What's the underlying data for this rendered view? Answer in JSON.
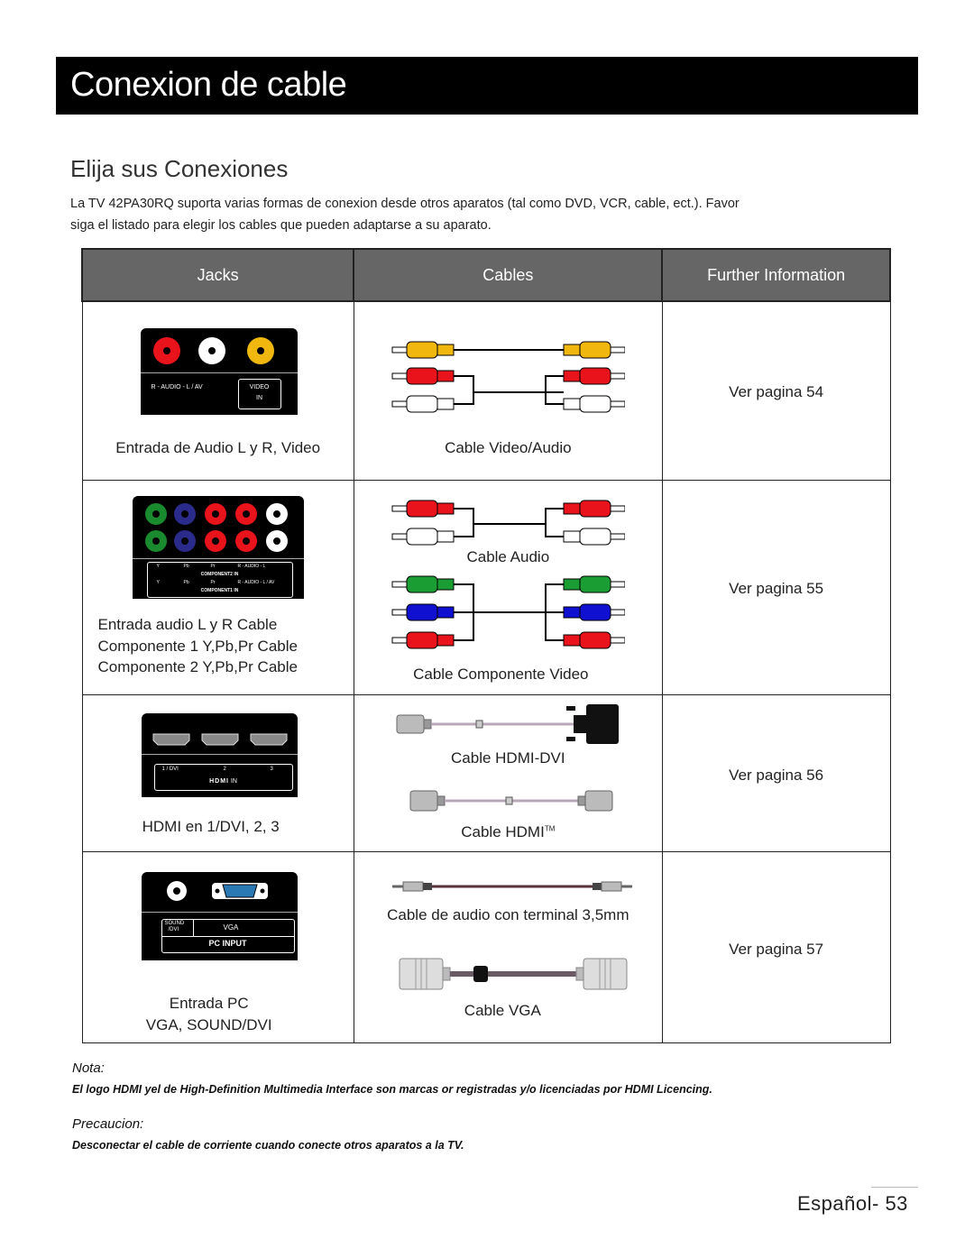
{
  "header": {
    "title": "Conexion de cable"
  },
  "section": {
    "subtitle": "Elija sus Conexiones",
    "intro_line1": "La TV  42PA30RQ suporta varias formas de conexion desde otros aparatos (tal como DVD, VCR, cable, ect.). Favor",
    "intro_line2": "siga el listado para elegir los cables que pueden adaptarse a su aparato."
  },
  "table": {
    "headers": [
      "Jacks",
      "Cables",
      "Further Information"
    ],
    "rows": [
      {
        "jack_panel": {
          "label_left": "R - AUDIO - L  / AV",
          "label_box_1": "VIDEO",
          "label_box_2": "IN",
          "jack_colors": [
            "#e8131b",
            "#ffffff",
            "#f0b80f"
          ]
        },
        "jack_caption": "Entrada de Audio L y R, Video",
        "cables": [
          {
            "label": "Cable Video/Audio"
          }
        ],
        "info": "Ver pagina 54"
      },
      {
        "jack_panel": {
          "row_colors": [
            "#1a8a2e",
            "#2b2b8c",
            "#e8131b",
            "#e8131b",
            "#ffffff"
          ],
          "comp2_labels": [
            "Y",
            "Pb",
            "Pr",
            "R - AUDIO - L"
          ],
          "comp2_title": "COMPONENT2  IN",
          "comp1_labels": [
            "Y",
            "Pb",
            "Pr",
            "R - AUDIO - L  / AV"
          ],
          "comp1_title": "COMPONENT1  IN"
        },
        "jack_caption_lines": [
          "Entrada audio L y R Cable",
          "Componente 1 Y,Pb,Pr Cable",
          "Componente 2 Y,Pb,Pr Cable"
        ],
        "cables": [
          {
            "label": "Cable Audio"
          },
          {
            "label": "Cable Componente Video"
          }
        ],
        "info": "Ver pagina 55"
      },
      {
        "jack_panel": {
          "port_labels": [
            "1 / DVI",
            "2",
            "3"
          ],
          "title": "HDMI",
          "title_suffix": "IN"
        },
        "jack_caption": "HDMI en 1/DVI, 2, 3",
        "cables": [
          {
            "label": "Cable HDMI-DVI"
          },
          {
            "label": "Cable HDMI",
            "trademark": "TM"
          }
        ],
        "info": "Ver pagina 56"
      },
      {
        "jack_panel": {
          "label_sound_1": "SOUND",
          "label_sound_2": "/DVI",
          "label_vga": "VGA",
          "title": "PC INPUT"
        },
        "jack_caption_lines": [
          "Entrada PC",
          "VGA, SOUND/DVI"
        ],
        "cables": [
          {
            "label": "Cable de audio con terminal 3,5mm"
          },
          {
            "label": "Cable VGA"
          }
        ],
        "info": "Ver pagina 57"
      }
    ]
  },
  "notes": {
    "nota_heading": "Nota:",
    "nota_text": "El logo HDMI yel de High-Definition Multimedia Interface son marcas or registradas y/o licenciadas por HDMI Licencing.",
    "precaucion_heading": "Precaucion:",
    "precaucion_text": "Desconectar el cable de corriente cuando conecte otros aparatos a la TV."
  },
  "footer": {
    "page_label": "Español- 53"
  }
}
